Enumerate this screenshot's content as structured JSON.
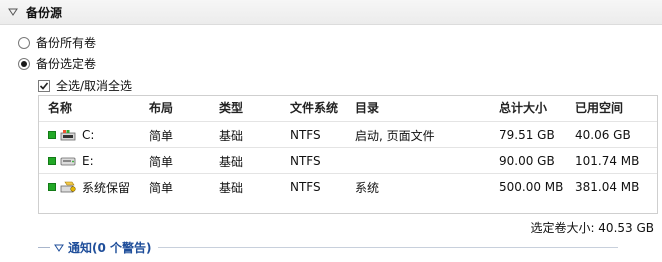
{
  "section": {
    "title": "备份源"
  },
  "options": {
    "all": "备份所有卷",
    "selected": "备份选定卷",
    "select_all": "全选/取消全选"
  },
  "table": {
    "headers": {
      "name": "名称",
      "layout": "布局",
      "type": "类型",
      "fs": "文件系统",
      "dir": "目录",
      "total": "总计大小",
      "used": "已用空间"
    },
    "rows": [
      {
        "name": "C:",
        "layout": "简单",
        "type": "基础",
        "fs": "NTFS",
        "dir": "启动, 页面文件",
        "total": "79.51 GB",
        "used": "40.06 GB",
        "icon": "windows-drive-icon"
      },
      {
        "name": "E:",
        "layout": "简单",
        "type": "基础",
        "fs": "NTFS",
        "dir": "",
        "total": "90.00 GB",
        "used": "101.74 MB",
        "icon": "drive-icon"
      },
      {
        "name": "系统保留",
        "layout": "简单",
        "type": "基础",
        "fs": "NTFS",
        "dir": "系统",
        "total": "500.00 MB",
        "used": "381.04 MB",
        "icon": "system-reserved-icon"
      }
    ]
  },
  "summary": {
    "text": "选定卷大小: 40.53 GB"
  },
  "notice": {
    "text": "通知(0 个警告)"
  },
  "colors": {
    "status_green": "#22a826",
    "link_blue": "#1f4e9a"
  }
}
